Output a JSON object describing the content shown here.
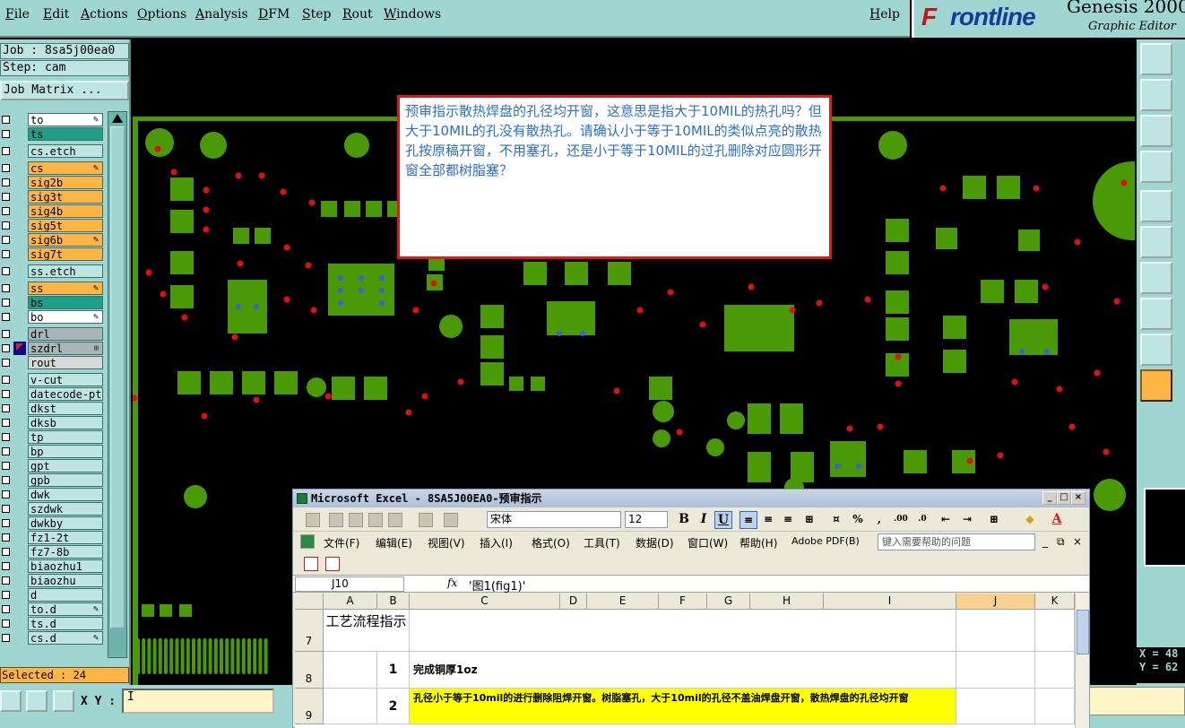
{
  "menubar": {
    "items": [
      "File",
      "Edit",
      "Actions",
      "Options",
      "Analysis",
      "DFM",
      "Step",
      "Rout",
      "Windows"
    ],
    "help": "Help"
  },
  "brand": {
    "logo_f": "F",
    "logo_rest": "rontline",
    "product": "Genesis 2000",
    "subtitle": "Graphic Editor"
  },
  "job": {
    "job_line": "Job : 8sa5j00ea0",
    "step_line": "Step: cam",
    "matrix_button": "Job Matrix ..."
  },
  "layers": [
    {
      "name": "to",
      "color": "#ffffff",
      "mark": "edit"
    },
    {
      "name": "ts",
      "color": "#1f9e8a",
      "mark": ""
    },
    {
      "name": "cs.etch",
      "color": "#bfe5e2",
      "mark": ""
    },
    {
      "name": "cs",
      "color": "#ffb545",
      "mark": "edit"
    },
    {
      "name": "sig2b",
      "color": "#ffb545",
      "mark": ""
    },
    {
      "name": "sig3t",
      "color": "#ffb545",
      "mark": ""
    },
    {
      "name": "sig4b",
      "color": "#ffb545",
      "mark": ""
    },
    {
      "name": "sig5t",
      "color": "#ffb545",
      "mark": ""
    },
    {
      "name": "sig6b",
      "color": "#ffb545",
      "mark": "edit"
    },
    {
      "name": "sig7t",
      "color": "#ffb545",
      "mark": ""
    },
    {
      "name": "ss.etch",
      "color": "#bfe5e2",
      "mark": ""
    },
    {
      "name": "ss",
      "color": "#ffb545",
      "mark": "edit"
    },
    {
      "name": "bs",
      "color": "#1f9e8a",
      "mark": ""
    },
    {
      "name": "bo",
      "color": "#ffffff",
      "mark": "edit"
    },
    {
      "name": "drl",
      "color": "#a9b6b5",
      "mark": ""
    },
    {
      "name": "szdrl",
      "color": "#a9b6b5",
      "mark": "grid",
      "active": true
    },
    {
      "name": "rout",
      "color": "#d8d8d8",
      "mark": ""
    },
    {
      "name": "v-cut",
      "color": "#bfe5e2",
      "mark": ""
    },
    {
      "name": "datecode-pte",
      "color": "#bfe5e2",
      "mark": ""
    },
    {
      "name": "dkst",
      "color": "#bfe5e2",
      "mark": ""
    },
    {
      "name": "dksb",
      "color": "#bfe5e2",
      "mark": ""
    },
    {
      "name": "tp",
      "color": "#bfe5e2",
      "mark": ""
    },
    {
      "name": "bp",
      "color": "#bfe5e2",
      "mark": ""
    },
    {
      "name": "gpt",
      "color": "#bfe5e2",
      "mark": ""
    },
    {
      "name": "gpb",
      "color": "#bfe5e2",
      "mark": ""
    },
    {
      "name": "dwk",
      "color": "#bfe5e2",
      "mark": ""
    },
    {
      "name": "szdwk",
      "color": "#bfe5e2",
      "mark": ""
    },
    {
      "name": "dwkby",
      "color": "#bfe5e2",
      "mark": ""
    },
    {
      "name": "fz1-2t",
      "color": "#bfe5e2",
      "mark": ""
    },
    {
      "name": "fz7-8b",
      "color": "#bfe5e2",
      "mark": ""
    },
    {
      "name": "biaozhu1",
      "color": "#bfe5e2",
      "mark": ""
    },
    {
      "name": "biaozhu",
      "color": "#bfe5e2",
      "mark": ""
    },
    {
      "name": "d",
      "color": "#bfe5e2",
      "mark": ""
    },
    {
      "name": "to.d",
      "color": "#bfe5e2",
      "mark": "edit"
    },
    {
      "name": "ts.d",
      "color": "#bfe5e2",
      "mark": ""
    },
    {
      "name": "cs.d",
      "color": "#bfe5e2",
      "mark": "edit"
    }
  ],
  "selected_text": "Selected : 24",
  "xy_label": "X Y :",
  "xy_value": "I",
  "coords": {
    "x": "X = 48",
    "y": "Y = 62"
  },
  "comment": "预审指示散热焊盘的孔径均开窗，这意思是指大于10MIL的热孔吗？但大于10MIL的孔没有散热孔。请确认小于等于10MIL的类似点亮的散热孔按原稿开窗，不用塞孔，还是小于等于10MIL的过孔删除对应圆形开窗全部都树脂塞？",
  "excel": {
    "title": "Microsoft Excel - 8SA5J00EA0-预审指示",
    "font": "宋体",
    "size": "12",
    "menu": [
      "文件(F)",
      "编辑(E)",
      "视图(V)",
      "插入(I)",
      "格式(O)",
      "工具(T)",
      "数据(D)",
      "窗口(W)",
      "帮助(H)",
      "Adobe PDF(B)"
    ],
    "help_placeholder": "键入需要帮助的问题",
    "namebox": "J10",
    "fx": "fx",
    "formula": "'图1(fig1)'",
    "columns": [
      "A",
      "B",
      "C",
      "D",
      "E",
      "F",
      "G",
      "H",
      "I",
      "J",
      "K"
    ],
    "rows": [
      {
        "num": "7",
        "a": "工艺流程指示",
        "b": "",
        "c": ""
      },
      {
        "num": "8",
        "a": "",
        "b": "1",
        "c": "完成铜厚1oz"
      },
      {
        "num": "9",
        "a": "",
        "b": "2",
        "c": "孔径小于等于10mil的进行删除阻焊开窗。树脂塞孔，大于10mil的孔径不盖油焊盘开窗，散热焊盘的孔径均开窗"
      }
    ]
  }
}
